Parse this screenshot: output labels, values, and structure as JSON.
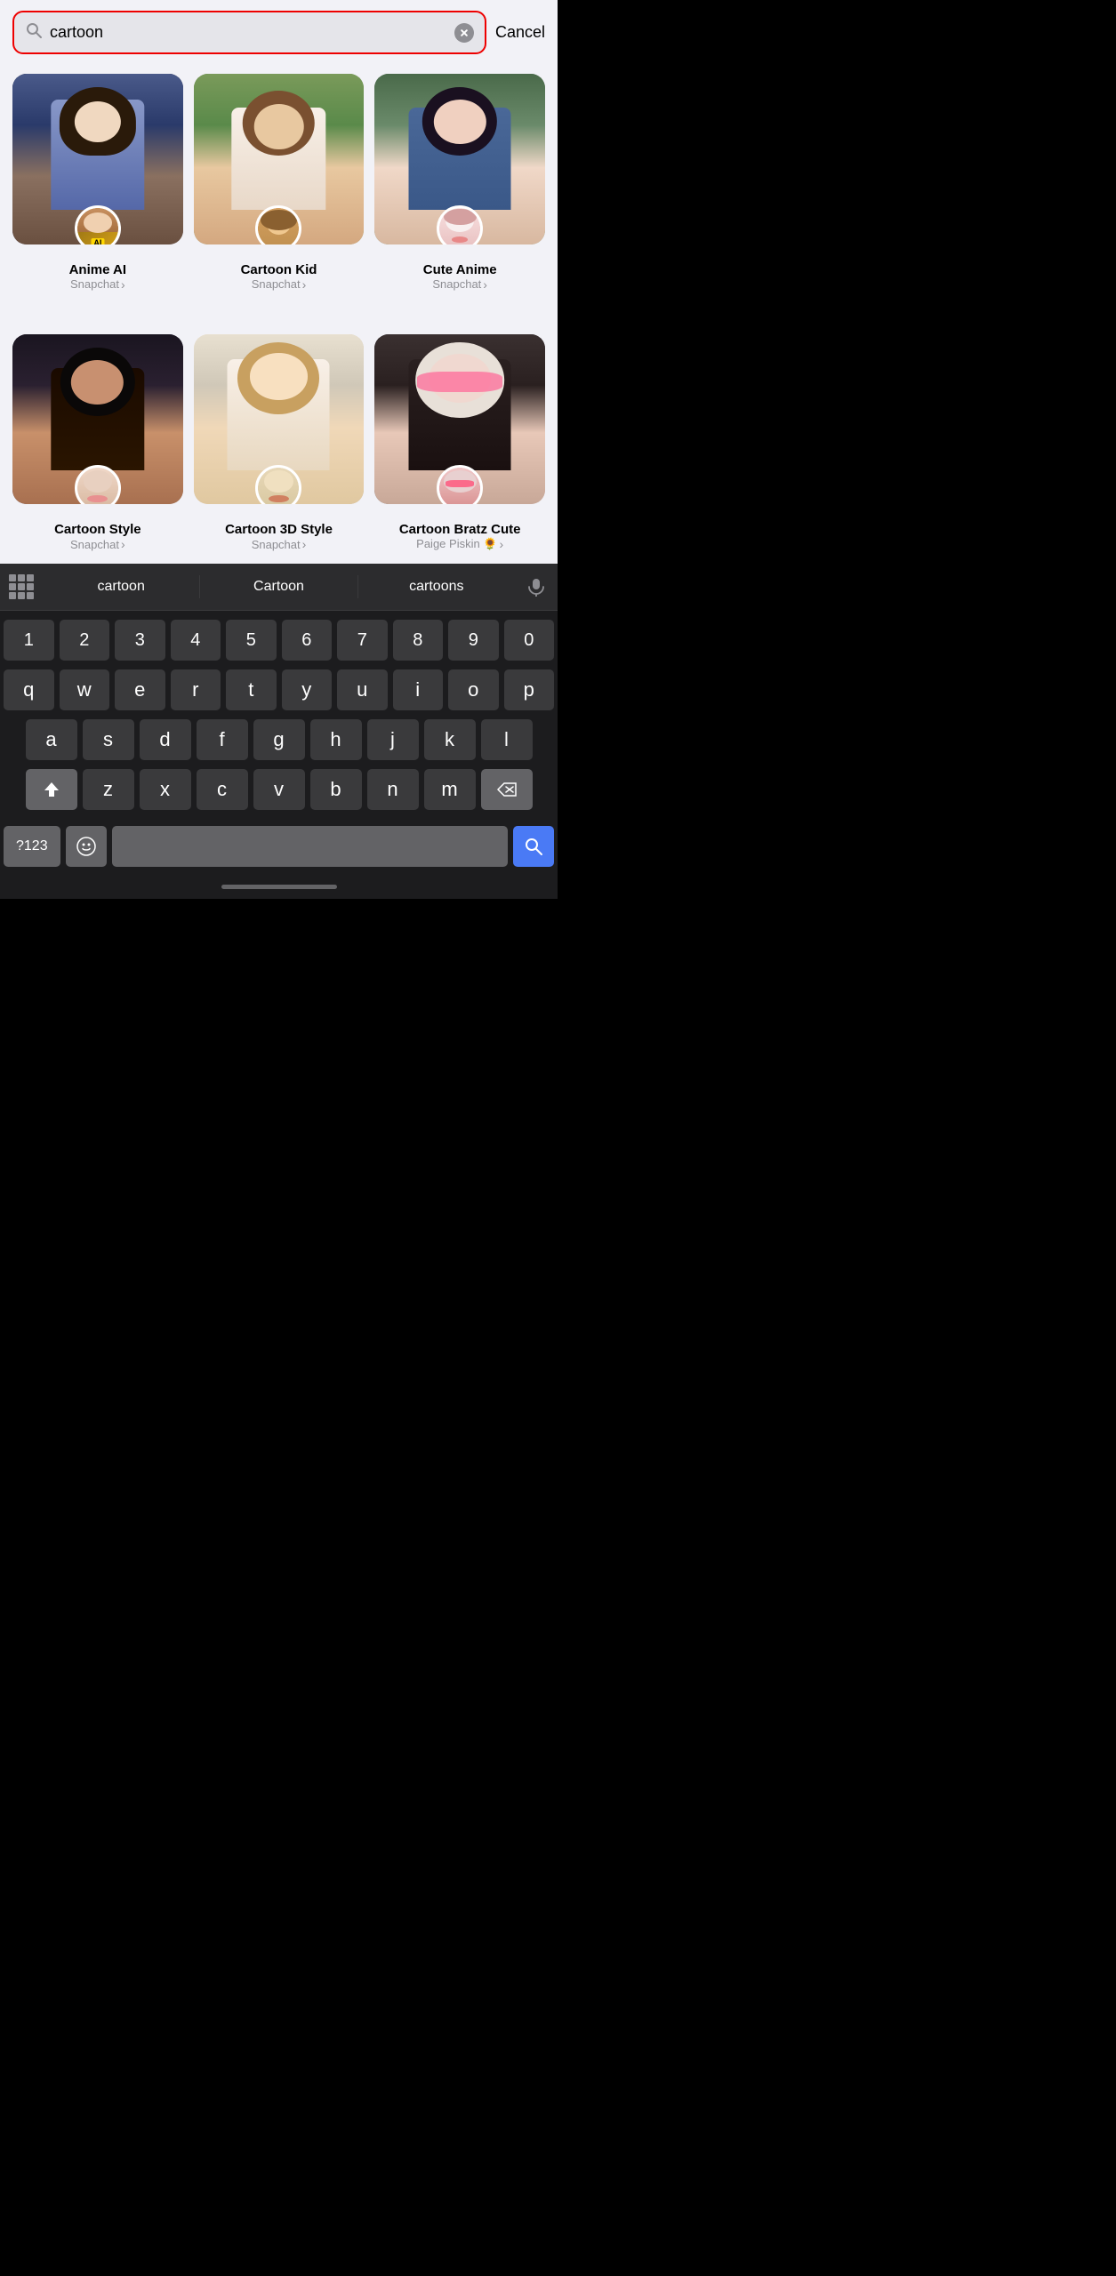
{
  "search": {
    "query": "cartoon",
    "placeholder": "Search",
    "clear_label": "Clear",
    "cancel_label": "Cancel"
  },
  "filters": {
    "row1": [
      {
        "id": "anime-ai",
        "name": "Anime AI",
        "source": "Snapchat",
        "avatar_label": "AI",
        "thumb_class": "thumb-anime-ai"
      },
      {
        "id": "cartoon-kid",
        "name": "Cartoon Kid",
        "source": "Snapchat",
        "avatar_label": "😊",
        "thumb_class": "thumb-cartoon-kid"
      },
      {
        "id": "cute-anime",
        "name": "Cute Anime",
        "source": "Snapchat",
        "avatar_label": "😍",
        "thumb_class": "thumb-cute-anime"
      }
    ],
    "row2": [
      {
        "id": "cartoon-style",
        "name": "Cartoon Style",
        "source": "Snapchat",
        "avatar_label": "🥺",
        "thumb_class": "thumb-cartoon-style"
      },
      {
        "id": "cartoon-3d-style",
        "name": "Cartoon 3D Style",
        "source": "Snapchat",
        "avatar_label": "😊",
        "thumb_class": "thumb-cartoon-3d"
      },
      {
        "id": "cartoon-bratz-cute",
        "name": "Cartoon Bratz Cute",
        "source": "Paige Piskin 🌻",
        "avatar_label": "😎",
        "thumb_class": "thumb-cartoon-bratz"
      }
    ]
  },
  "keyboard": {
    "autocomplete": {
      "suggestions": [
        "cartoon",
        "Cartoon",
        "cartoons"
      ]
    },
    "rows": {
      "numbers": [
        "1",
        "2",
        "3",
        "4",
        "5",
        "6",
        "7",
        "8",
        "9",
        "0"
      ],
      "row1": [
        "q",
        "w",
        "e",
        "r",
        "t",
        "y",
        "u",
        "i",
        "o",
        "p"
      ],
      "row2": [
        "a",
        "s",
        "d",
        "f",
        "g",
        "h",
        "j",
        "k",
        "l"
      ],
      "row3": [
        "z",
        "x",
        "c",
        "v",
        "b",
        "n",
        "m"
      ],
      "bottom": {
        "special_left": "?123",
        "emoji": "☺",
        "space": "",
        "search": "🔍",
        "backspace": "⌫",
        "shift": "⇧"
      }
    }
  }
}
